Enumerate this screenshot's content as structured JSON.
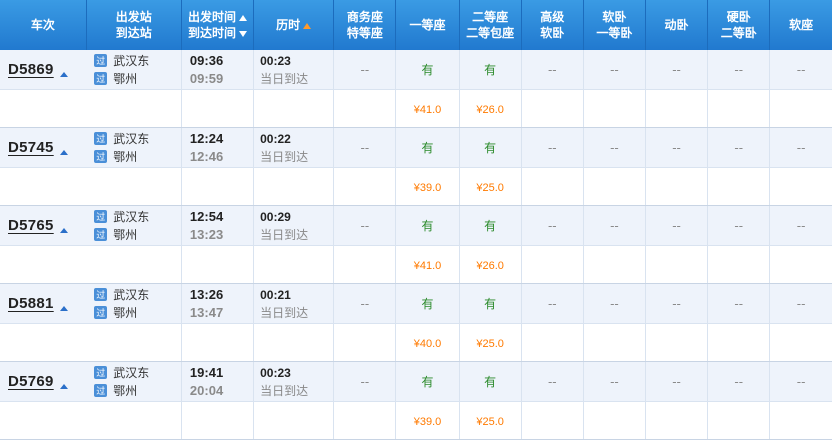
{
  "header": {
    "col_train": "车次",
    "col_station_1": "出发站",
    "col_station_2": "到达站",
    "col_time_1": "出发时间",
    "col_time_2": "到达时间",
    "col_duration": "历时",
    "col_business_1": "商务座",
    "col_business_2": "特等座",
    "col_first": "一等座",
    "col_second_1": "二等座",
    "col_second_2": "二等包座",
    "col_premium_1": "高级",
    "col_premium_2": "软卧",
    "col_softsleep_1": "软卧",
    "col_softsleep_2": "一等卧",
    "col_dongwo": "动卧",
    "col_hardsleep_1": "硬卧",
    "col_hardsleep_2": "二等卧",
    "col_softseat": "软座"
  },
  "badge_text": "过",
  "trains": [
    {
      "no": "D5869",
      "from": "武汉东",
      "to": "鄂州",
      "dep": "09:36",
      "arr": "09:59",
      "duration": "00:23",
      "arrive_note": "当日到达",
      "business": "--",
      "first": "有",
      "second": "有",
      "premium_soft": "--",
      "soft_sleep": "--",
      "dongwo": "--",
      "hard_sleep": "--",
      "soft_seat": "--",
      "price_first": "¥41.0",
      "price_second": "¥26.0"
    },
    {
      "no": "D5745",
      "from": "武汉东",
      "to": "鄂州",
      "dep": "12:24",
      "arr": "12:46",
      "duration": "00:22",
      "arrive_note": "当日到达",
      "business": "--",
      "first": "有",
      "second": "有",
      "premium_soft": "--",
      "soft_sleep": "--",
      "dongwo": "--",
      "hard_sleep": "--",
      "soft_seat": "--",
      "price_first": "¥39.0",
      "price_second": "¥25.0"
    },
    {
      "no": "D5765",
      "from": "武汉东",
      "to": "鄂州",
      "dep": "12:54",
      "arr": "13:23",
      "duration": "00:29",
      "arrive_note": "当日到达",
      "business": "--",
      "first": "有",
      "second": "有",
      "premium_soft": "--",
      "soft_sleep": "--",
      "dongwo": "--",
      "hard_sleep": "--",
      "soft_seat": "--",
      "price_first": "¥41.0",
      "price_second": "¥26.0"
    },
    {
      "no": "D5881",
      "from": "武汉东",
      "to": "鄂州",
      "dep": "13:26",
      "arr": "13:47",
      "duration": "00:21",
      "arrive_note": "当日到达",
      "business": "--",
      "first": "有",
      "second": "有",
      "premium_soft": "--",
      "soft_sleep": "--",
      "dongwo": "--",
      "hard_sleep": "--",
      "soft_seat": "--",
      "price_first": "¥40.0",
      "price_second": "¥25.0"
    },
    {
      "no": "D5769",
      "from": "武汉东",
      "to": "鄂州",
      "dep": "19:41",
      "arr": "20:04",
      "duration": "00:23",
      "arrive_note": "当日到达",
      "business": "--",
      "first": "有",
      "second": "有",
      "premium_soft": "--",
      "soft_sleep": "--",
      "dongwo": "--",
      "hard_sleep": "--",
      "soft_seat": "--",
      "price_first": "¥39.0",
      "price_second": "¥25.0"
    }
  ]
}
